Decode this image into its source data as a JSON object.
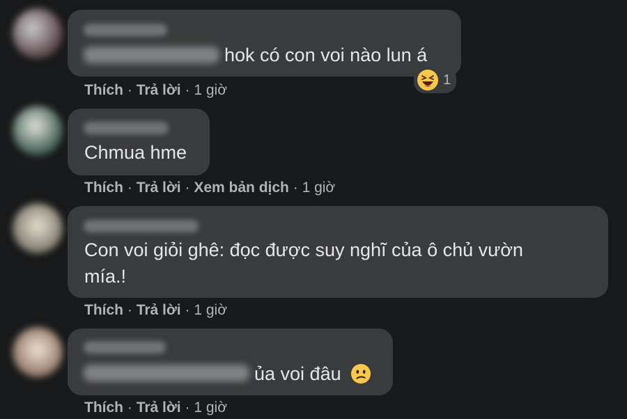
{
  "comments": [
    {
      "text": "hok có con voi nào lun á",
      "reaction": {
        "emoji": "laughing-emoji",
        "count": "1"
      },
      "actions": {
        "like": "Thích",
        "reply": "Trả lời",
        "time": "1 giờ"
      }
    },
    {
      "text": "Chmua hme",
      "actions": {
        "like": "Thích",
        "reply": "Trả lời",
        "translate": "Xem bản dịch",
        "time": "1 giờ"
      }
    },
    {
      "text_line1": "Con voi giỏi ghê: đọc được suy nghĩ của ô chủ vườn",
      "text_line2": "mía.!",
      "actions": {
        "like": "Thích",
        "reply": "Trả lời",
        "time": "1 giờ"
      }
    },
    {
      "text": "ủa voi đâu",
      "inline_emoji": "confused-emoji",
      "actions": {
        "like": "Thích",
        "reply": "Trả lời",
        "time": "1 giờ"
      }
    }
  ],
  "separator": "·",
  "colors": {
    "background": "#18191a",
    "bubble": "#3a3b3c",
    "text": "#e4e6eb",
    "secondary": "#b0b3b8"
  }
}
